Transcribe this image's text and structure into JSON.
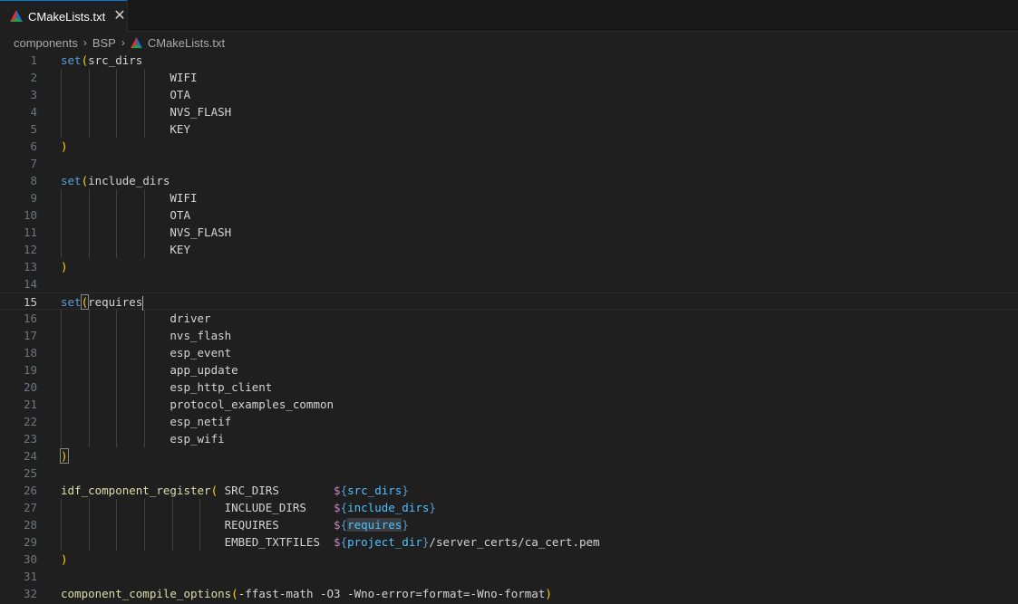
{
  "tab": {
    "label": "CMakeLists.txt",
    "close": "✕"
  },
  "breadcrumb": {
    "items": [
      "components",
      "BSP",
      "CMakeLists.txt"
    ],
    "separator": "›"
  },
  "theme": {
    "background": "#1f1f1f",
    "keyword": "#569cd6",
    "function": "#dcdcaa",
    "bracket": "#ffd700",
    "variable": "#4fc1ff",
    "dollar": "#c586c0",
    "cmake_icon_colors": [
      "#e03131",
      "#1971c2",
      "#2f9e44"
    ]
  },
  "editor": {
    "current_line": 15,
    "lines": [
      {
        "n": "1",
        "text": "set(src_dirs"
      },
      {
        "n": "2",
        "text": "                WIFI"
      },
      {
        "n": "3",
        "text": "                OTA"
      },
      {
        "n": "4",
        "text": "                NVS_FLASH"
      },
      {
        "n": "5",
        "text": "                KEY"
      },
      {
        "n": "6",
        "text": ")"
      },
      {
        "n": "7",
        "text": ""
      },
      {
        "n": "8",
        "text": "set(include_dirs"
      },
      {
        "n": "9",
        "text": "                WIFI"
      },
      {
        "n": "10",
        "text": "                OTA"
      },
      {
        "n": "11",
        "text": "                NVS_FLASH"
      },
      {
        "n": "12",
        "text": "                KEY"
      },
      {
        "n": "13",
        "text": ")"
      },
      {
        "n": "14",
        "text": ""
      },
      {
        "n": "15",
        "text": "set(requires"
      },
      {
        "n": "16",
        "text": "                driver"
      },
      {
        "n": "17",
        "text": "                nvs_flash"
      },
      {
        "n": "18",
        "text": "                esp_event"
      },
      {
        "n": "19",
        "text": "                app_update"
      },
      {
        "n": "20",
        "text": "                esp_http_client"
      },
      {
        "n": "21",
        "text": "                protocol_examples_common"
      },
      {
        "n": "22",
        "text": "                esp_netif"
      },
      {
        "n": "23",
        "text": "                esp_wifi"
      },
      {
        "n": "24",
        "text": ")"
      },
      {
        "n": "25",
        "text": ""
      },
      {
        "n": "26",
        "text": "idf_component_register( SRC_DIRS        ${src_dirs}"
      },
      {
        "n": "27",
        "text": "                        INCLUDE_DIRS    ${include_dirs}"
      },
      {
        "n": "28",
        "text": "                        REQUIRES        ${requires}"
      },
      {
        "n": "29",
        "text": "                        EMBED_TXTFILES  ${project_dir}/server_certs/ca_cert.pem"
      },
      {
        "n": "30",
        "text": ")"
      },
      {
        "n": "31",
        "text": ""
      },
      {
        "n": "32",
        "text": "component_compile_options(-ffast-math -O3 -Wno-error=format=-Wno-format)"
      }
    ]
  }
}
